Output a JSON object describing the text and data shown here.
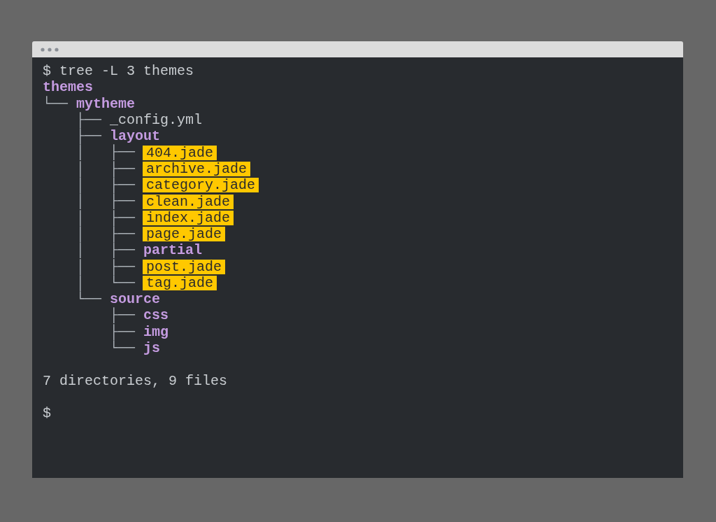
{
  "terminal": {
    "lines": [
      {
        "kind": "command",
        "text": "$ tree -L 3 themes"
      },
      {
        "kind": "dir",
        "name": "themes"
      },
      {
        "kind": "dir",
        "prefix": "└── ",
        "name": "mytheme"
      },
      {
        "kind": "file",
        "prefix": "    ├── ",
        "name": "_config.yml",
        "highlighted": false
      },
      {
        "kind": "dir",
        "prefix": "    ├── ",
        "name": "layout"
      },
      {
        "kind": "file",
        "prefix": "    │   ├── ",
        "name": "404.jade",
        "highlighted": true
      },
      {
        "kind": "file",
        "prefix": "    │   ├── ",
        "name": "archive.jade",
        "highlighted": true
      },
      {
        "kind": "file",
        "prefix": "    │   ├── ",
        "name": "category.jade",
        "highlighted": true
      },
      {
        "kind": "file",
        "prefix": "    │   ├── ",
        "name": "clean.jade",
        "highlighted": true
      },
      {
        "kind": "file",
        "prefix": "    │   ├── ",
        "name": "index.jade",
        "highlighted": true
      },
      {
        "kind": "file",
        "prefix": "    │   ├── ",
        "name": "page.jade",
        "highlighted": true
      },
      {
        "kind": "dir",
        "prefix": "    │   ├── ",
        "name": "partial"
      },
      {
        "kind": "file",
        "prefix": "    │   ├── ",
        "name": "post.jade",
        "highlighted": true
      },
      {
        "kind": "file",
        "prefix": "    │   └── ",
        "name": "tag.jade",
        "highlighted": true
      },
      {
        "kind": "dir",
        "prefix": "    └── ",
        "name": "source"
      },
      {
        "kind": "dir",
        "prefix": "        ├── ",
        "name": "css"
      },
      {
        "kind": "dir",
        "prefix": "        ├── ",
        "name": "img"
      },
      {
        "kind": "dir",
        "prefix": "        └── ",
        "name": "js"
      },
      {
        "kind": "blank"
      },
      {
        "kind": "summary",
        "text": "7 directories, 9 files"
      },
      {
        "kind": "blank"
      },
      {
        "kind": "command",
        "text": "$"
      }
    ]
  }
}
